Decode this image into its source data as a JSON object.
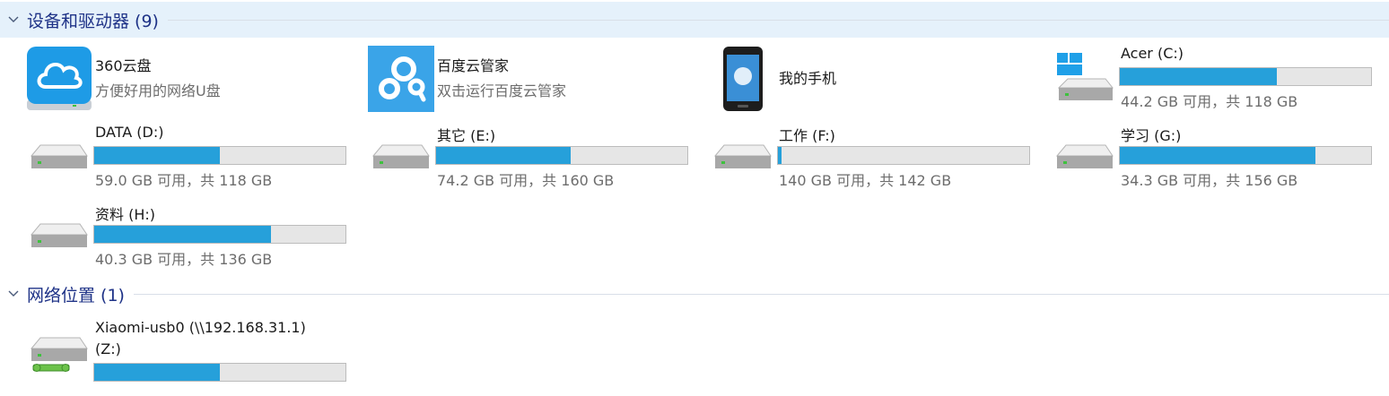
{
  "sections": {
    "devices": {
      "title": "设备和驱动器 (9)"
    },
    "network": {
      "title": "网络位置 (1)"
    }
  },
  "apps": [
    {
      "name": "360云盘",
      "desc": "方便好用的网络U盘",
      "icon": "360-cloud-icon"
    },
    {
      "name": "百度云管家",
      "desc": "双击运行百度云管家",
      "icon": "baidu-cloud-icon"
    },
    {
      "name": "我的手机",
      "icon": "phone-icon"
    }
  ],
  "drives": [
    {
      "name": "Acer (C:)",
      "free_text": "44.2 GB 可用，共 118 GB",
      "used_fraction": 0.625,
      "icon": "windows-drive-icon"
    },
    {
      "name": "DATA (D:)",
      "free_text": "59.0 GB 可用，共 118 GB",
      "used_fraction": 0.5,
      "icon": "hard-drive-icon"
    },
    {
      "name": "其它 (E:)",
      "free_text": "74.2 GB 可用，共 160 GB",
      "used_fraction": 0.536,
      "icon": "hard-drive-icon"
    },
    {
      "name": "工作 (F:)",
      "free_text": "140 GB 可用，共 142 GB",
      "used_fraction": 0.014,
      "icon": "hard-drive-icon"
    },
    {
      "name": "学习 (G:)",
      "free_text": "34.3 GB 可用，共 156 GB",
      "used_fraction": 0.78,
      "icon": "hard-drive-icon"
    },
    {
      "name": "资料 (H:)",
      "free_text": "40.3 GB 可用，共 136 GB",
      "used_fraction": 0.704,
      "icon": "hard-drive-icon"
    }
  ],
  "network_drive": {
    "name_line1": "Xiaomi-usb0 (\\\\192.168.31.1)",
    "name_line2": "(Z:)",
    "used_fraction": 0.5,
    "icon": "network-drive-icon"
  },
  "colors": {
    "header_bg": "#e5f1fb",
    "header_text": "#1e3287",
    "bar_fill": "#26a0da",
    "bar_bg": "#e6e6e6"
  }
}
